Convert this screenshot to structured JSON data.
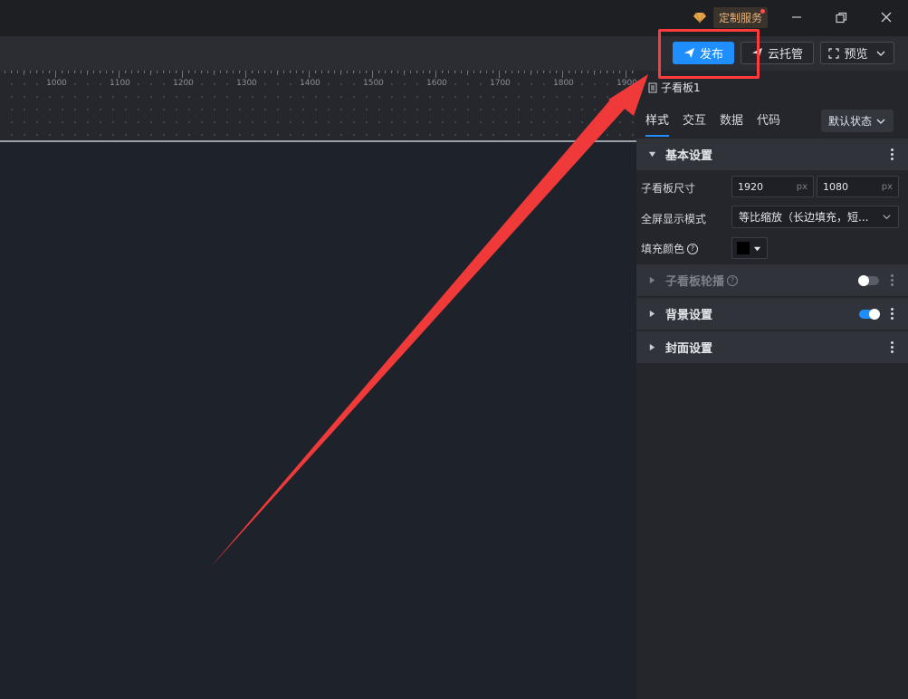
{
  "titlebar": {
    "service_label": "定制服务",
    "icons": [
      "diamond-icon",
      "minimize-icon",
      "restore-icon",
      "close-icon"
    ]
  },
  "toolbar": {
    "publish_label": "发布",
    "cloud_label": "云托管",
    "preview_label": "预览"
  },
  "ruler": {
    "labels": [
      "1000",
      "1100",
      "1200",
      "1300",
      "1400",
      "1500",
      "1600",
      "1700",
      "1800",
      "1900"
    ]
  },
  "panel": {
    "title": "子看板1",
    "tabs": [
      "样式",
      "交互",
      "数据",
      "代码"
    ],
    "state_select": "默认状态",
    "basic_section": "基本设置",
    "size_label": "子看板尺寸",
    "width_value": "1920",
    "height_value": "1080",
    "unit": "px",
    "fullscreen_label": "全屏显示模式",
    "fullscreen_value": "等比缩放（长边填充，短...",
    "fill_label": "填充颜色",
    "carousel_section": "子看板轮播",
    "background_section": "背景设置",
    "cover_section": "封面设置",
    "help_glyph": "?"
  },
  "colors": {
    "accent": "#1f8fff",
    "highlight": "#ff3b3b",
    "fill_color": "#000000"
  },
  "toggles": {
    "carousel_on": false,
    "background_on": true
  }
}
